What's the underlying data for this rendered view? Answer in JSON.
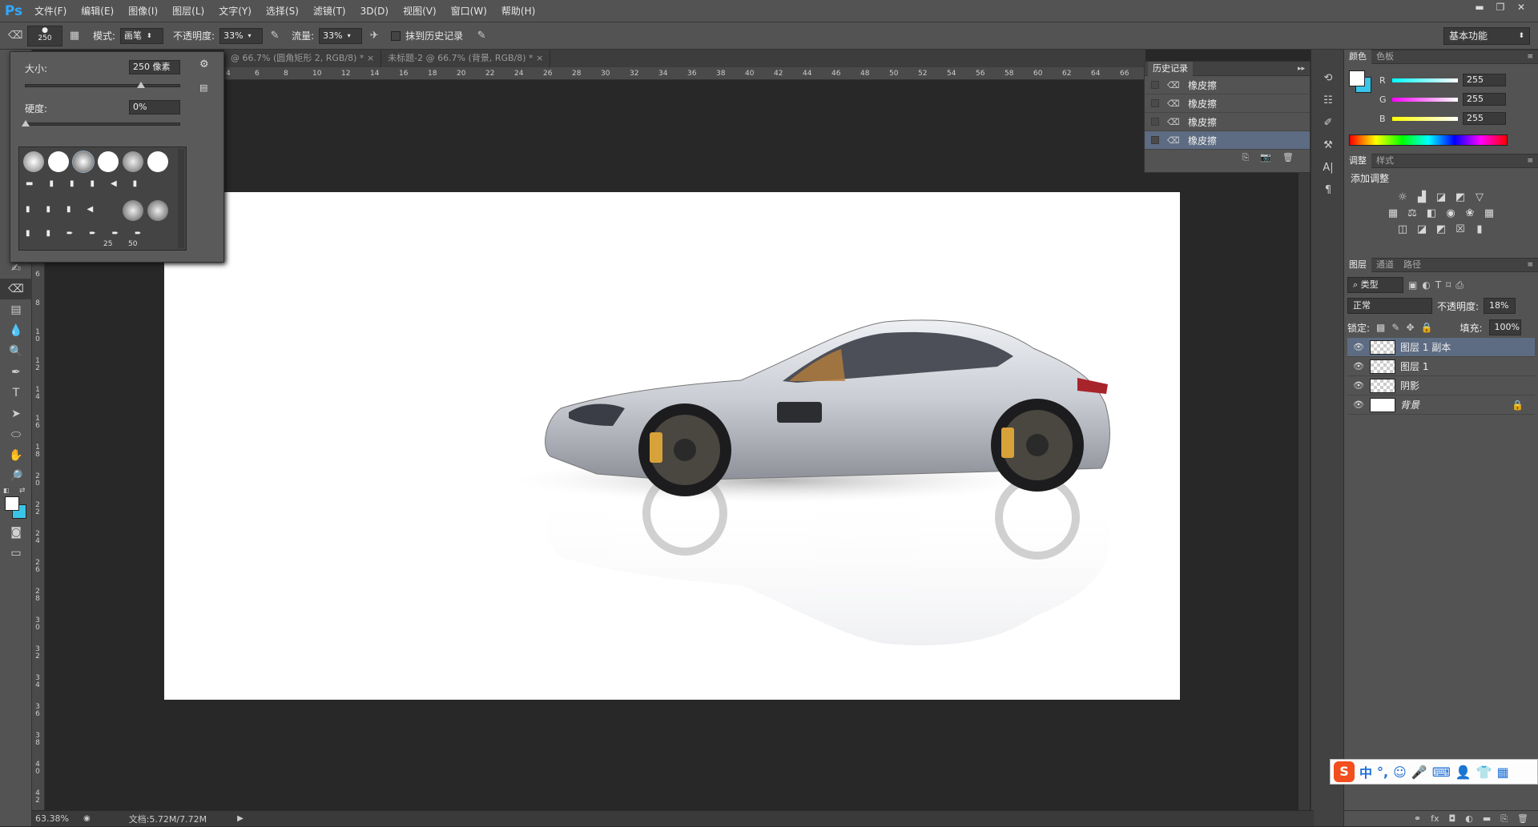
{
  "app": {
    "logo": "Ps"
  },
  "menu": [
    "文件(F)",
    "编辑(E)",
    "图像(I)",
    "图层(L)",
    "文字(Y)",
    "选择(S)",
    "滤镜(T)",
    "3D(D)",
    "视图(V)",
    "窗口(W)",
    "帮助(H)"
  ],
  "window_controls": {
    "minimize": "▬",
    "restore": "❐",
    "close": "✕"
  },
  "options": {
    "brush_size": "250",
    "mode_label": "模式:",
    "mode_value": "画笔",
    "opacity_label": "不透明度:",
    "opacity_value": "33%",
    "flow_label": "流量:",
    "flow_value": "33%",
    "erase_history_label": "抹到历史记录",
    "workspace": "基本功能"
  },
  "brush_popup": {
    "size_label": "大小:",
    "size_value": "250 像素",
    "hardness_label": "硬度:",
    "hardness_value": "0%",
    "size_slider": 0.74,
    "hardness_slider": 0.0,
    "tip_numbers": [
      "25",
      "50"
    ]
  },
  "tabs": [
    {
      "label": "@ 66.7% (圆角矩形 2, RGB/8) *",
      "close": "×"
    },
    {
      "label": "未标题-2 @ 66.7% (背景, RGB/8) *",
      "close": "×"
    }
  ],
  "ruler_h": [
    "4",
    "6",
    "8",
    "10",
    "12",
    "14",
    "16",
    "18",
    "20",
    "22",
    "24",
    "26",
    "28",
    "30",
    "32",
    "34",
    "36",
    "38",
    "40",
    "42",
    "44",
    "46",
    "48",
    "50",
    "52",
    "54",
    "56",
    "58",
    "60",
    "62",
    "64",
    "66"
  ],
  "ruler_v": [
    "6",
    "8",
    "1\n0",
    "1\n2",
    "1\n4",
    "1\n6",
    "1\n8",
    "2\n0",
    "2\n2",
    "2\n4",
    "2\n6",
    "2\n8",
    "3\n0",
    "3\n2",
    "3\n4",
    "3\n6",
    "3\n8",
    "4\n0",
    "4\n2"
  ],
  "history": {
    "title": "历史记录",
    "items": [
      "橡皮擦",
      "橡皮擦",
      "橡皮擦",
      "橡皮擦"
    ],
    "selected_index": 3
  },
  "color_panel": {
    "tabs": [
      "颜色",
      "色板"
    ],
    "channels": [
      {
        "label": "R",
        "value": "255"
      },
      {
        "label": "G",
        "value": "255"
      },
      {
        "label": "B",
        "value": "255"
      }
    ],
    "foreground": "#ffffff",
    "background": "#39c5e8"
  },
  "adjust_panel": {
    "tabs": [
      "调整",
      "样式"
    ],
    "title": "添加调整"
  },
  "layers_panel": {
    "tabs": [
      "图层",
      "通道",
      "路径"
    ],
    "filter_label": "类型",
    "blend_mode": "正常",
    "opacity_label": "不透明度:",
    "opacity_value": "18%",
    "lock_label": "锁定:",
    "fill_label": "填充:",
    "fill_value": "100%",
    "layers": [
      {
        "name": "图层 1 副本",
        "selected": true
      },
      {
        "name": "图层 1",
        "selected": false
      },
      {
        "name": "阴影",
        "selected": false
      },
      {
        "name": "背景",
        "selected": false,
        "locked": true
      }
    ]
  },
  "status": {
    "zoom": "63.38%",
    "doc_info": "文档:5.72M/7.72M"
  },
  "ime": {
    "items": [
      "中",
      "°,",
      "☺",
      "🎤",
      "⌨",
      "👤",
      "👕",
      "▦"
    ]
  }
}
